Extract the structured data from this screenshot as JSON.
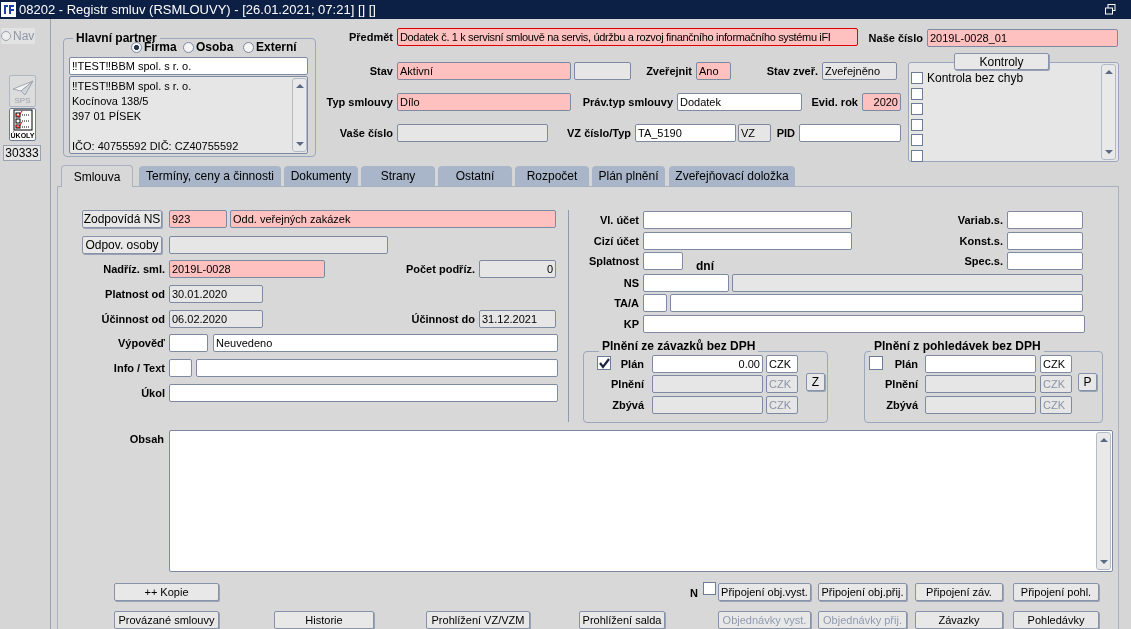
{
  "window": {
    "title": "08202 - Registr smluv (RSMLOUVY) - [26.01.2021; 07:21] [] []"
  },
  "toolbar": {
    "nav": {
      "label": "Nav",
      "selected": false
    },
    "sps_label": "SPS",
    "ukoly_label": "ÚKOLY",
    "record_count": "30333"
  },
  "partner": {
    "title": "Hlavní partner",
    "options": [
      {
        "label": "Firma",
        "selected": true
      },
      {
        "label": "Osoba",
        "selected": false
      },
      {
        "label": "Externí",
        "selected": false
      }
    ],
    "name": "‼TEST‼BBM spol. s r. o.",
    "address_lines": [
      "‼TEST‼BBM spol. s r. o.",
      "Kocínova 138/5",
      "397 01 PÍSEK"
    ],
    "ids": "IČO: 40755592 DIČ: CZ40755592"
  },
  "header": {
    "fields": [
      {
        "label": "Předmět",
        "value": "Dodatek č. 1 k servisní smlouvě na servis, údržbu a rozvoj finančního informačního systému iFI",
        "required": true,
        "readonly": false,
        "focused": true
      },
      {
        "label": "Naše číslo",
        "value": "2019L-0028_01",
        "required": true,
        "readonly": false,
        "focused": false
      },
      {
        "label": "Stav",
        "value": "Aktivní",
        "required": true,
        "readonly": false,
        "focused": false
      },
      {
        "required": false,
        "readonly": true,
        "focused": false
      },
      {
        "label": "Zveřejnit",
        "value": "Ano",
        "required": true,
        "readonly": false,
        "focused": false
      },
      {
        "label": "Stav zveř.",
        "value": "Zveřejněno",
        "required": false,
        "readonly": true,
        "focused": false
      },
      {
        "label": "Typ smlouvy",
        "value": "Dílo",
        "required": true,
        "readonly": false,
        "focused": false
      },
      {
        "label": "Práv.typ smlouvy",
        "value": "Dodatek",
        "required": false,
        "readonly": false,
        "focused": false
      },
      {
        "label": "Evid. rok",
        "value": "2020",
        "required": true,
        "readonly": false,
        "focused": false
      },
      {
        "label": "Vaše číslo",
        "required": false,
        "readonly": true,
        "focused": false
      },
      {
        "label": "VZ číslo/Typ",
        "value": "TA_5190",
        "required": false,
        "readonly": false,
        "focused": false
      },
      {
        "value": "VZ",
        "required": false,
        "readonly": true,
        "focused": false
      },
      {
        "label": "PID",
        "required": false,
        "readonly": false,
        "focused": false
      }
    ]
  },
  "kontroly": {
    "button": "Kontroly",
    "checks": [
      {
        "label": "Kontrola bez chyb",
        "checked": false
      },
      {
        "checked": false
      },
      {
        "checked": false
      },
      {
        "checked": false
      },
      {
        "checked": false
      },
      {
        "checked": false
      }
    ]
  },
  "tabs": [
    {
      "label": "Smlouva",
      "selected": true
    },
    {
      "label": "Termíny, ceny a činnosti",
      "selected": false
    },
    {
      "label": "Dokumenty",
      "selected": false
    },
    {
      "label": "Strany",
      "selected": false
    },
    {
      "label": "Ostatní",
      "selected": false
    },
    {
      "label": "Rozpočet",
      "selected": false
    },
    {
      "label": "Plán plnění",
      "selected": false
    },
    {
      "label": "Zveřejňovací doložka",
      "selected": false
    }
  ],
  "form": [
    {
      "kind": "button",
      "label": "Zodpovídá NS"
    },
    {
      "kind": "field",
      "value": "923",
      "required": true,
      "readonly": false
    },
    {
      "kind": "field",
      "value": "Odd. veřejných zakázek",
      "required": true,
      "readonly": false
    },
    {
      "kind": "button",
      "label": "Odpov. osoby"
    },
    {
      "kind": "field",
      "required": false,
      "readonly": true
    },
    {
      "kind": "field",
      "label": "Nadříz. sml.",
      "value": "2019L-0028",
      "required": true,
      "readonly": false
    },
    {
      "kind": "field",
      "label": "Počet podříz.",
      "value": "0",
      "required": false,
      "readonly": true
    },
    {
      "kind": "field",
      "label": "Platnost od",
      "value": "30.01.2020",
      "required": false,
      "readonly": true
    },
    {
      "kind": "field",
      "label": "Účinnost od",
      "value": "06.02.2020",
      "required": false,
      "readonly": true
    },
    {
      "kind": "field",
      "label": "Účinnost do",
      "value": "31.12.2021",
      "required": false,
      "readonly": true
    },
    {
      "kind": "field",
      "label": "Výpověď",
      "required": false,
      "readonly": false
    },
    {
      "kind": "field",
      "value": "Neuvedeno",
      "required": false,
      "readonly": false
    },
    {
      "kind": "field",
      "label": "Info / Text",
      "required": false,
      "readonly": false
    },
    {
      "kind": "field",
      "required": false,
      "readonly": false
    },
    {
      "kind": "field",
      "label": "Úkol",
      "required": false,
      "readonly": false
    },
    {
      "kind": "field",
      "label": "Vl. účet",
      "required": false,
      "readonly": false
    },
    {
      "kind": "field",
      "label": "Variab.s.",
      "required": false,
      "readonly": false
    },
    {
      "kind": "field",
      "label": "Cizí účet",
      "required": false,
      "readonly": false
    },
    {
      "kind": "field",
      "label": "Konst.s.",
      "required": false,
      "readonly": false
    },
    {
      "kind": "field",
      "label": "Splatnost",
      "required": false,
      "readonly": false
    },
    {
      "kind": "text",
      "label": "dní"
    },
    {
      "kind": "field",
      "label": "Spec.s.",
      "required": false,
      "readonly": false
    },
    {
      "kind": "field",
      "label": "NS",
      "required": false,
      "readonly": false
    },
    {
      "kind": "field",
      "required": false,
      "readonly": true
    },
    {
      "kind": "field",
      "label": "TA/A",
      "required": false,
      "readonly": false
    },
    {
      "kind": "field",
      "required": false,
      "readonly": false
    },
    {
      "kind": "field",
      "label": "KP",
      "required": false,
      "readonly": false
    }
  ],
  "groups": [
    {
      "title": "Plnění ze závazků bez DPH",
      "checked": true,
      "button": "Z",
      "rows": [
        {
          "label": "Plán",
          "value": "0.00",
          "currency": "CZK",
          "readonly": false
        },
        {
          "label": "Plnění",
          "currency": "CZK",
          "readonly": true
        },
        {
          "label": "Zbývá",
          "currency": "CZK",
          "readonly": true
        }
      ]
    },
    {
      "title": "Plnění z pohledávek bez DPH",
      "checked": false,
      "button": "P",
      "rows": [
        {
          "label": "Plán",
          "currency": "CZK",
          "readonly": false
        },
        {
          "label": "Plnění",
          "currency": "CZK",
          "readonly": true
        },
        {
          "label": "Zbývá",
          "currency": "CZK",
          "readonly": true
        }
      ]
    }
  ],
  "obsah": {
    "label": "Obsah"
  },
  "buttons": [
    {
      "kind": "button",
      "label": "++ Kopie",
      "disabled": false
    },
    {
      "kind": "checkbox",
      "label": "N",
      "checked": false
    },
    {
      "kind": "button",
      "label": "Připojení obj.vyst.",
      "disabled": false
    },
    {
      "kind": "button",
      "label": "Připojení obj.přij.",
      "disabled": false
    },
    {
      "kind": "button",
      "label": "Připojení záv.",
      "disabled": false
    },
    {
      "kind": "button",
      "label": "Připojení pohl.",
      "disabled": false
    },
    {
      "kind": "button",
      "label": "Provázané smlouvy",
      "disabled": false
    },
    {
      "kind": "button",
      "label": "Historie",
      "disabled": false
    },
    {
      "kind": "button",
      "label": "Prohlížení VZ/VZM",
      "disabled": false
    },
    {
      "kind": "button",
      "label": "Prohlížení salda",
      "disabled": false
    },
    {
      "kind": "button",
      "label": "Objednávky vyst.",
      "disabled": true
    },
    {
      "kind": "button",
      "label": "Objednávky přij.",
      "disabled": true
    },
    {
      "kind": "button",
      "label": "Závazky",
      "disabled": false
    },
    {
      "kind": "button",
      "label": "Pohledávky",
      "disabled": false
    }
  ]
}
